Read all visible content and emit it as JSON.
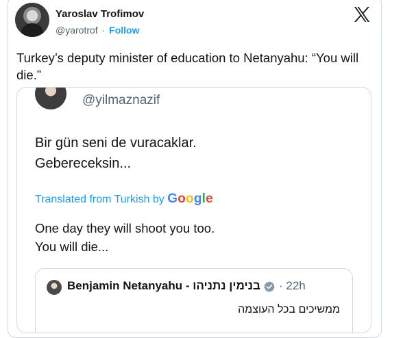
{
  "author": {
    "name": "Yaroslav Trofimov",
    "handle": "@yarotrof",
    "separator": "·",
    "follow_label": "Follow"
  },
  "platform_icon": "x-logo-icon",
  "tweet_text": "Turkey’s deputy minister of education to Netanyahu: “You will die.”",
  "embedded": {
    "handle": "@yilmaznazif",
    "turkish_text": "Bir gün seni de vuracaklar.\nGebereceksin...",
    "translated_label": "Translated from Turkish by ",
    "google_letters": [
      "G",
      "o",
      "o",
      "g",
      "l",
      "e"
    ],
    "english_text": "One day they will shoot you too.\nYou will die...",
    "quoted": {
      "name": "Benjamin Netanyahu - בנימין נתניהו",
      "verified_icon": "verified-badge-icon",
      "time": "· 22h",
      "text": "ממשיכים בכל העוצמה"
    }
  },
  "colors": {
    "link": "#1d9bf0",
    "text": "#0f1419",
    "muted": "#536471",
    "border": "#cfd9de",
    "verified": "#829aab"
  }
}
